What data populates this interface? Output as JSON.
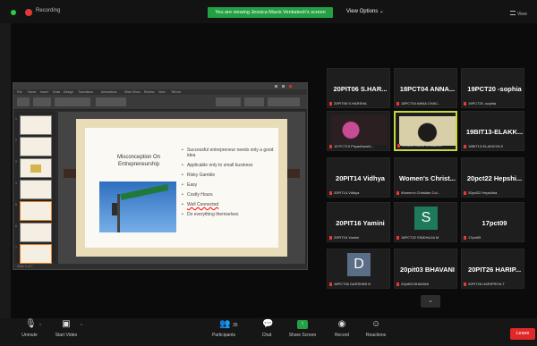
{
  "window": {
    "recording_label": "Recording",
    "viewing_banner": "You are viewing Jessica Mavis Venkatesh's screen",
    "view_options": "View Options ⌄",
    "view_menu": "View"
  },
  "shared_screen": {
    "ribbon_tabs": [
      "File",
      "Home",
      "Insert",
      "Draw",
      "Design",
      "Transitions",
      "Animations",
      "Slide Show",
      "Review",
      "View",
      "Tell me"
    ],
    "thumbnail_numbers": [
      "1",
      "2",
      "3",
      "4",
      "5",
      "6",
      "7"
    ],
    "slide": {
      "title": "Misconception On Entrepreneurship",
      "bullets": [
        "Successful entrepreneur needs only a good idea",
        "Applicable only to small business",
        "Risky Gamble",
        "Easy",
        "Costly Hours",
        "Well Connected",
        "Do everything themselves"
      ]
    },
    "status_text": "Slide 4 of 7"
  },
  "participants": [
    {
      "name": "20PIT06 S.HAR...",
      "label": "20PIT06 S.HARSHA"
    },
    {
      "name": "18PCT04 ANNA...",
      "label": "18PCT04 ANNA CHAC..."
    },
    {
      "name": "19PCT20 -sophia",
      "label": "19PCT20 -sophia"
    },
    {
      "name": "",
      "label": "19 PCT19 Priyadharshi..."
    },
    {
      "name": "",
      "label": "Jessica Mavis Venkatesh"
    },
    {
      "name": "19BIT13-ELAKK...",
      "label": "19BIT13-ELAKKIYA S"
    },
    {
      "name": "20PIT14 Vidhya",
      "label": "20PIT14 Vidhya"
    },
    {
      "name": "Women's Christ...",
      "label": "Women's Christian Col..."
    },
    {
      "name": "20pct22 Hepshi...",
      "label": "20pct22 Hepshiba"
    },
    {
      "name": "20PIT16 Yamini",
      "label": "20PIT16 Yamini"
    },
    {
      "name": "",
      "avatar": "S",
      "label": "18PCT22 SINDHUJA M"
    },
    {
      "name": "17pct09",
      "label": "17pct09"
    },
    {
      "name": "",
      "avatar": "D",
      "label": "18PCT06 DARSHINI N"
    },
    {
      "name": "20pit03 BHAVANI",
      "label": "20pit03 BHAVANI"
    },
    {
      "name": "20PIT26 HARIP...",
      "label": "20PIT26 HARIPRIYA T"
    }
  ],
  "more_chevron": "⌄",
  "toolbar": {
    "unmute": "Unmute",
    "start_video": "Start Video",
    "participants": "Participants",
    "participants_count": "35",
    "chat": "Chat",
    "share_screen": "Share Screen",
    "record": "Record",
    "reactions": "Reactions",
    "leave": "Leave"
  },
  "icons": {
    "mic": "microphone-muted-icon",
    "video": "video-off-icon",
    "participants": "people-icon",
    "chat": "speech-bubble-icon",
    "share": "share-arrow-icon",
    "record": "record-icon",
    "reactions": "smiley-icon"
  },
  "colors": {
    "banner_green": "#23a043",
    "leave_red": "#e02828",
    "active_speaker": "#c7d93c"
  }
}
